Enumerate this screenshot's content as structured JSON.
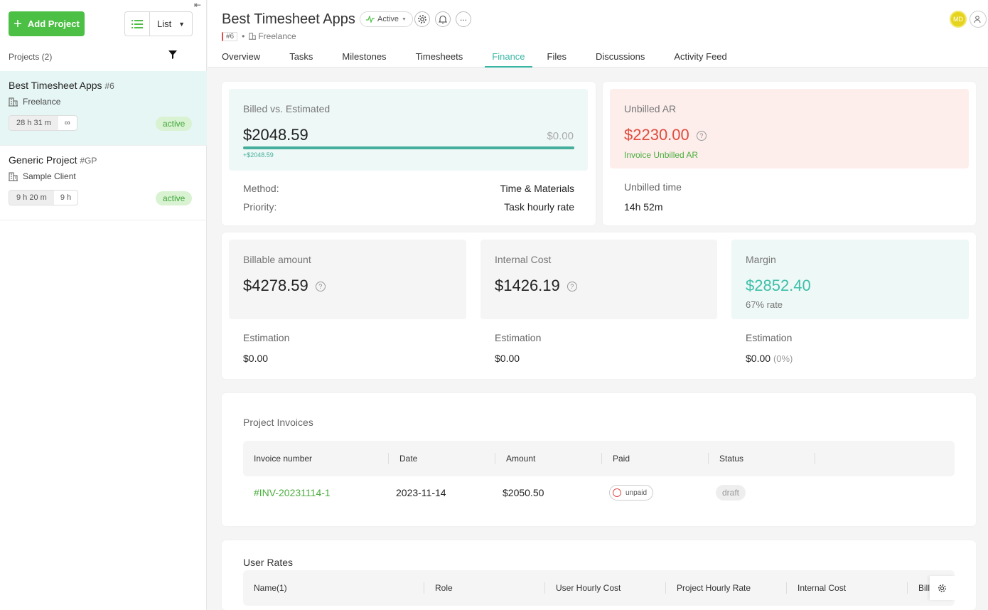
{
  "sidebar": {
    "add_project": "Add Project",
    "view_label": "List",
    "projects_label": "Projects (2)",
    "projects": [
      {
        "name": "Best Timesheet Apps",
        "num": "#6",
        "client": "Freelance",
        "time": "28 h 31 m",
        "budget": "∞",
        "status": "active"
      },
      {
        "name": "Generic Project",
        "num": "#GP",
        "client": "Sample Client",
        "time": "9 h 20 m",
        "budget": "9 h",
        "status": "active"
      }
    ]
  },
  "header": {
    "title": "Best Timesheet Apps",
    "status": "Active",
    "tag": "#6",
    "client": "Freelance",
    "avatar": "MD",
    "tabs": [
      "Overview",
      "Tasks",
      "Milestones",
      "Timesheets",
      "Finance",
      "Files",
      "Discussions",
      "Activity Feed"
    ],
    "active_tab": "Finance"
  },
  "billed": {
    "label": "Billed vs. Estimated",
    "amount": "$2048.59",
    "estimated": "$0.00",
    "delta": "+$2048.59",
    "progress": 1.0,
    "method_label": "Method:",
    "method_value": "Time & Materials",
    "priority_label": "Priority:",
    "priority_value": "Task hourly rate"
  },
  "unbilled": {
    "label": "Unbilled AR",
    "amount": "$2230.00",
    "link": "Invoice Unbilled AR",
    "time_label": "Unbilled time",
    "time_value": "14h 52m"
  },
  "stats": {
    "billable": {
      "label": "Billable amount",
      "amount": "$4278.59",
      "est_label": "Estimation",
      "est_value": "$0.00"
    },
    "internal": {
      "label": "Internal Cost",
      "amount": "$1426.19",
      "est_label": "Estimation",
      "est_value": "$0.00"
    },
    "margin": {
      "label": "Margin",
      "amount": "$2852.40",
      "rate": "67% rate",
      "est_label": "Estimation",
      "est_value": "$0.00",
      "est_pct": "(0%)"
    }
  },
  "invoices": {
    "title": "Project Invoices",
    "headers": [
      "Invoice number",
      "Date",
      "Amount",
      "Paid",
      "Status"
    ],
    "rows": [
      {
        "number": "#INV-20231114-1",
        "date": "2023-11-14",
        "amount": "$2050.50",
        "paid": "unpaid",
        "status": "draft"
      }
    ]
  },
  "user_rates": {
    "title": "User Rates",
    "headers": [
      "Name(1)",
      "Role",
      "User Hourly Cost",
      "Project Hourly Rate",
      "Internal Cost",
      "Billa"
    ]
  },
  "colors": {
    "accent": "#3bb6a6",
    "green": "#4cbf45",
    "red": "#e04b4b"
  }
}
